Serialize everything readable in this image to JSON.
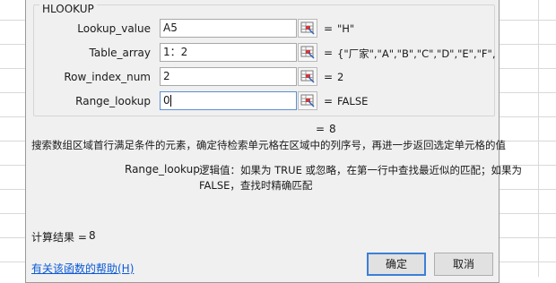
{
  "dialog": {
    "group_title": "HLOOKUP",
    "args": [
      {
        "label": "Lookup_value",
        "value": "A5",
        "result": "\"H\""
      },
      {
        "label": "Table_array",
        "value": "1：2",
        "result": "{\"厂家\",\"A\",\"B\",\"C\",\"D\",\"E\",\"F\",\"G\",\"H"
      },
      {
        "label": "Row_index_num",
        "value": "2",
        "result": "2"
      },
      {
        "label": "Range_lookup",
        "value": "0",
        "result": "FALSE"
      }
    ],
    "equals_sign": "=",
    "formula_result": "8",
    "description": "搜索数组区域首行满足条件的元素，确定待检索单元格在区域中的列序号，再进一步返回选定单元格的值",
    "arg_help_name": "Range_lookup",
    "arg_help_line1": "逻辑值：如果为 TRUE 或忽略，在第一行中查找最近似的匹配；如果为",
    "arg_help_line2": "FALSE，查找时精确匹配",
    "calc_result_label": "计算结果 =",
    "calc_result_value": "8",
    "help_link": "有关该函数的帮助(H)",
    "ok_label": "确定",
    "cancel_label": "取消"
  }
}
